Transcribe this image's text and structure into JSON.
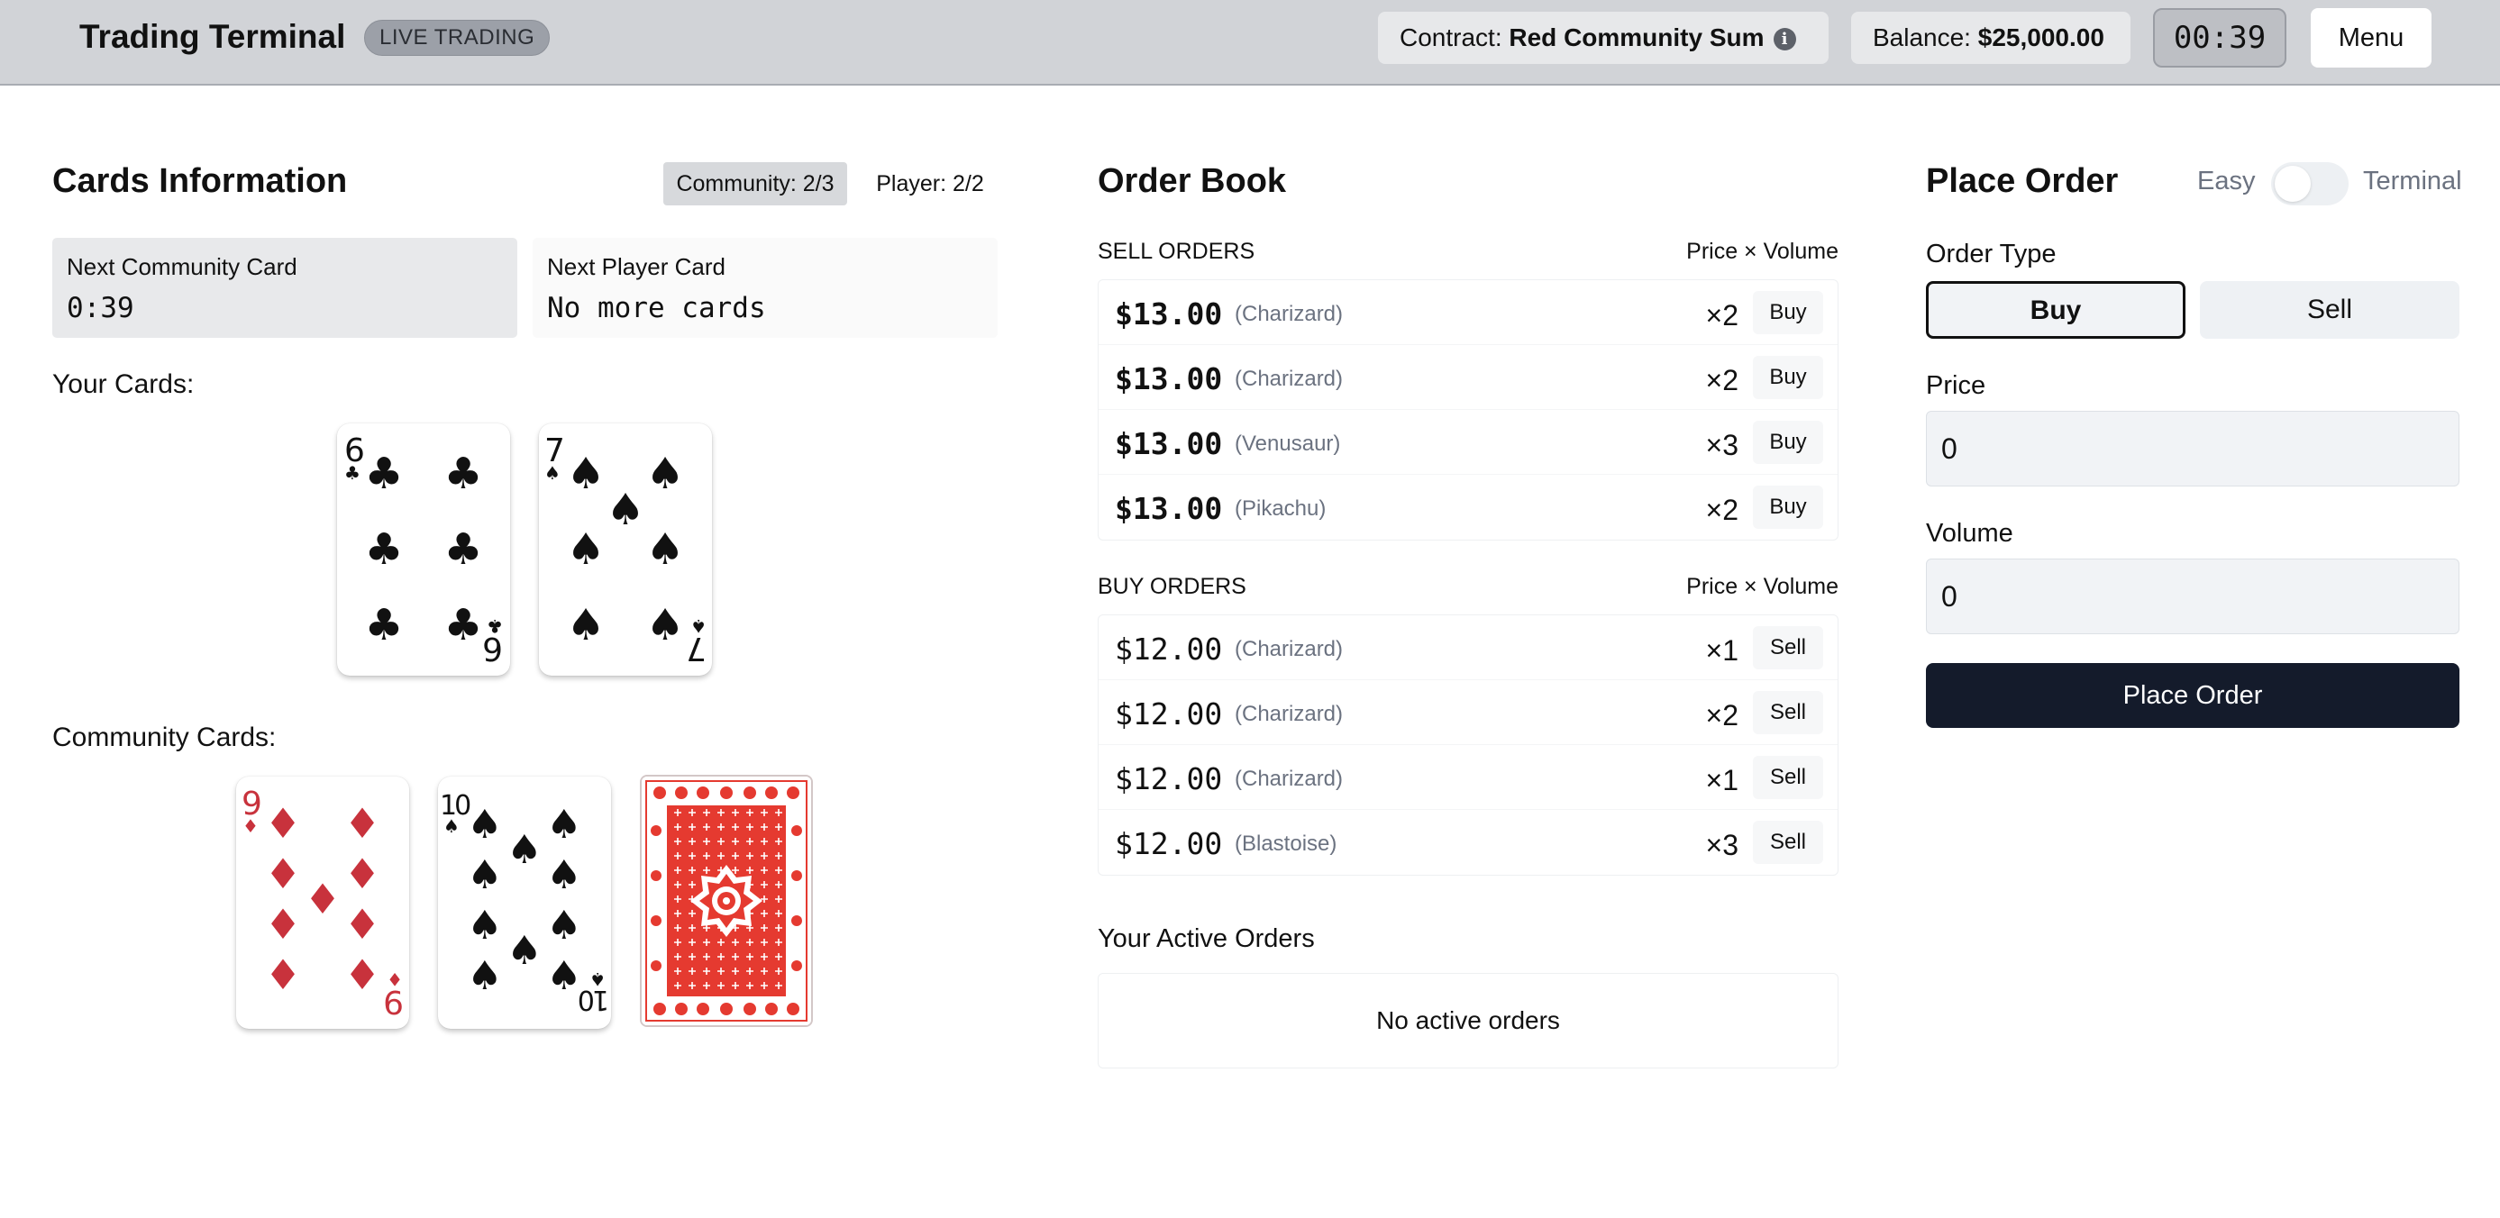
{
  "header": {
    "title": "Trading Terminal",
    "badge": "LIVE TRADING",
    "contract_label": "Contract:",
    "contract_value": "Red Community Sum",
    "balance_label": "Balance:",
    "balance_value": "$25,000.00",
    "timer": "00:39",
    "menu_label": "Menu"
  },
  "cards_info": {
    "title": "Cards Information",
    "community_count": "Community: 2/3",
    "player_count": "Player: 2/2",
    "next_community": {
      "label": "Next Community Card",
      "value": "0:39"
    },
    "next_player": {
      "label": "Next Player Card",
      "value": "No more cards"
    },
    "your_cards_label": "Your Cards:",
    "your_cards": [
      {
        "rank": "6",
        "suit": "clubs"
      },
      {
        "rank": "7",
        "suit": "spades"
      }
    ],
    "community_cards_label": "Community Cards:",
    "community_cards": [
      {
        "rank": "9",
        "suit": "diamonds"
      },
      {
        "rank": "10",
        "suit": "spades"
      },
      {
        "rank": "",
        "suit": "face-down"
      }
    ]
  },
  "order_book": {
    "title": "Order Book",
    "sell_header": "SELL ORDERS",
    "buy_header": "BUY ORDERS",
    "price_volume_header": "Price × Volume",
    "sell_orders": [
      {
        "price": "$13.00",
        "name": "(Charizard)",
        "volume": "×2",
        "action": "Buy"
      },
      {
        "price": "$13.00",
        "name": "(Charizard)",
        "volume": "×2",
        "action": "Buy"
      },
      {
        "price": "$13.00",
        "name": "(Venusaur)",
        "volume": "×3",
        "action": "Buy"
      },
      {
        "price": "$13.00",
        "name": "(Pikachu)",
        "volume": "×2",
        "action": "Buy"
      }
    ],
    "buy_orders": [
      {
        "price": "$12.00",
        "name": "(Charizard)",
        "volume": "×1",
        "action": "Sell"
      },
      {
        "price": "$12.00",
        "name": "(Charizard)",
        "volume": "×2",
        "action": "Sell"
      },
      {
        "price": "$12.00",
        "name": "(Charizard)",
        "volume": "×1",
        "action": "Sell"
      },
      {
        "price": "$12.00",
        "name": "(Blastoise)",
        "volume": "×3",
        "action": "Sell"
      }
    ],
    "active_orders_title": "Your Active Orders",
    "active_orders_empty": "No active orders"
  },
  "place_order": {
    "title": "Place Order",
    "mode_easy": "Easy",
    "mode_terminal": "Terminal",
    "order_type_label": "Order Type",
    "buy_label": "Buy",
    "sell_label": "Sell",
    "price_label": "Price",
    "price_value": "0",
    "volume_label": "Volume",
    "volume_value": "0",
    "submit_label": "Place Order"
  },
  "colors": {
    "header_bg": "#d1d3d7",
    "red_suit": "#c8323c",
    "black_suit": "#111111",
    "card_back": "#e53a30",
    "submit_bg": "#141b2b"
  }
}
